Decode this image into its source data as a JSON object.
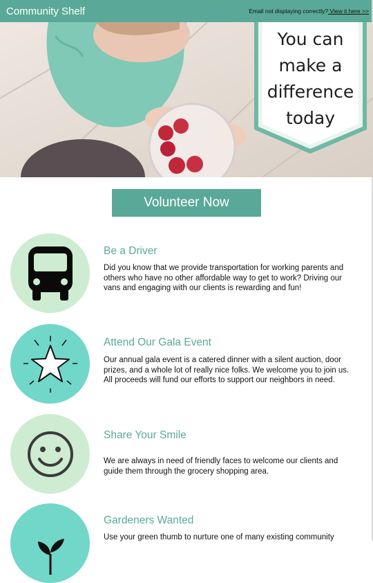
{
  "header": {
    "brand": "Community Shelf",
    "email_note": "Email not displaying correctly?",
    "view_link": " View it here >>"
  },
  "hero": {
    "banner_lines": [
      "You can",
      "make a",
      "difference",
      "today"
    ]
  },
  "cta": {
    "label": "Volunteer Now"
  },
  "items": [
    {
      "title": "Be a Driver",
      "icon": "bus-icon",
      "description": "Did you know that we provide transportation for working parents and others who have no other affordable way to get to work? Driving our vans and engaging with our clients is rewarding and fun!"
    },
    {
      "title": "Attend Our Gala Event",
      "icon": "star-icon",
      "description": "Our annual gala event is a catered dinner with a silent auction, door prizes, and a whole lot of really nice folks. We welcome you to join us. All proceeds will fund our efforts to support our neighbors in need."
    },
    {
      "title": "Share Your Smile",
      "icon": "smiley-face-icon",
      "description": "We are always in need of friendly faces to welcome our clients and guide them through the grocery shopping area."
    },
    {
      "title": "Gardeners Wanted",
      "icon": "plant-icon",
      "description": "Use your green thumb to nurture one of many existing community"
    }
  ],
  "colors": {
    "brand_teal": "#5aa998",
    "light_green": "#cdecd1",
    "teal_circle": "#71d7c8"
  }
}
